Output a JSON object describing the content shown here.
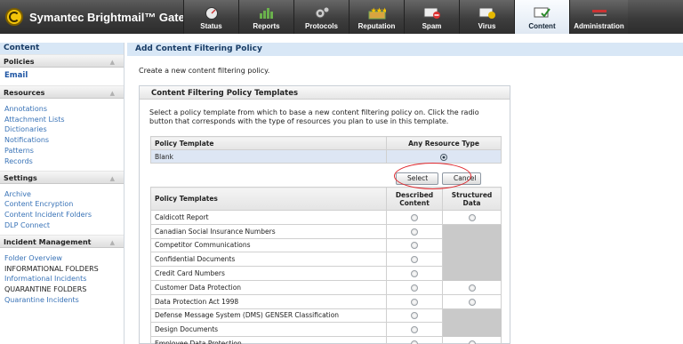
{
  "app": {
    "title": "Symantec Brightmail™ Gateway"
  },
  "tabs": [
    {
      "label": "Status",
      "icon": "gauge-icon"
    },
    {
      "label": "Reports",
      "icon": "bar-chart-icon"
    },
    {
      "label": "Protocols",
      "icon": "gears-icon"
    },
    {
      "label": "Reputation",
      "icon": "stars-icon"
    },
    {
      "label": "Spam",
      "icon": "mail-block-icon"
    },
    {
      "label": "Virus",
      "icon": "mail-virus-icon"
    },
    {
      "label": "Content",
      "icon": "mail-check-icon",
      "active": true
    },
    {
      "label": "Administration",
      "icon": "tools-icon"
    }
  ],
  "sidebar": {
    "title": "Content",
    "sections": [
      {
        "label": "Policies",
        "items": [
          "Email"
        ]
      },
      {
        "label": "Resources",
        "items": [
          "Annotations",
          "Attachment Lists",
          "Dictionaries",
          "Notifications",
          "Patterns",
          "Records"
        ]
      },
      {
        "label": "Settings",
        "items": [
          "Archive",
          "Content Encryption",
          "Content Incident Folders",
          "DLP Connect"
        ]
      },
      {
        "label": "Incident Management",
        "items": [
          "Folder Overview",
          "INFORMATIONAL FOLDERS",
          "Informational Incidents",
          "QUARANTINE FOLDERS",
          "Quarantine Incidents"
        ]
      }
    ]
  },
  "main": {
    "title": "Add Content Filtering Policy",
    "intro": "Create a new content filtering policy.",
    "panel_title": "Content Filtering Policy Templates",
    "panel_desc": "Select a policy template from which to base a new content filtering policy on. Click the radio button that corresponds with the type of resources you plan to use in this template.",
    "top_table": {
      "col_template": "Policy Template",
      "col_any": "Any Resource Type",
      "row": "Blank"
    },
    "select_label": "Select",
    "cancel_label": "Cancel",
    "templates_table": {
      "col_name": "Policy Templates",
      "col_described": "Described Content",
      "col_structured": "Structured Data",
      "rows": [
        {
          "name": "Caldicott Report",
          "described": true,
          "structured": true
        },
        {
          "name": "Canadian Social Insurance Numbers",
          "described": true,
          "structured": false
        },
        {
          "name": "Competitor Communications",
          "described": true,
          "structured": false
        },
        {
          "name": "Confidential Documents",
          "described": true,
          "structured": false
        },
        {
          "name": "Credit Card Numbers",
          "described": true,
          "structured": false
        },
        {
          "name": "Customer Data Protection",
          "described": true,
          "structured": true
        },
        {
          "name": "Data Protection Act 1998",
          "described": true,
          "structured": true
        },
        {
          "name": "Defense Message System (DMS) GENSER Classification",
          "described": true,
          "structured": false
        },
        {
          "name": "Design Documents",
          "described": true,
          "structured": false
        },
        {
          "name": "Employee Data Protection",
          "described": true,
          "structured": true
        }
      ]
    }
  },
  "colors": {
    "topbar": "#3a3a3a",
    "header_blue": "#d8e7f6",
    "link": "#3973b7",
    "highlight": "#e0282e"
  }
}
